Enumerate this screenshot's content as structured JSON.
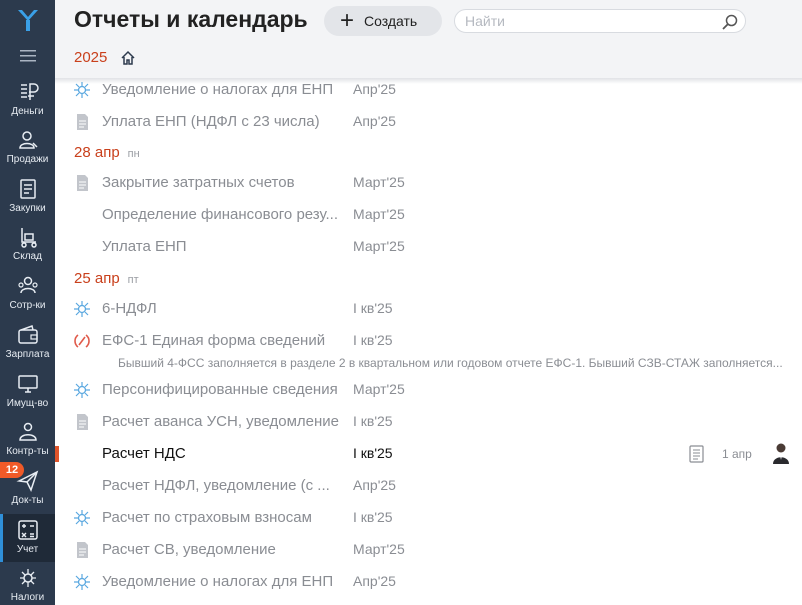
{
  "header": {
    "title": "Отчеты и календарь",
    "create_label": "Создать",
    "search_placeholder": "Найти",
    "year": "2025"
  },
  "sidebar": {
    "badge": "12",
    "items": [
      {
        "label": "Деньги",
        "icon": "money-icon"
      },
      {
        "label": "Продажи",
        "icon": "sales-icon"
      },
      {
        "label": "Закупки",
        "icon": "purchases-icon"
      },
      {
        "label": "Склад",
        "icon": "warehouse-icon"
      },
      {
        "label": "Сотр-ки",
        "icon": "employees-icon"
      },
      {
        "label": "Зарплата",
        "icon": "salary-icon"
      },
      {
        "label": "Имущ-во",
        "icon": "property-icon"
      },
      {
        "label": "Контр-ты",
        "icon": "contractors-icon"
      },
      {
        "label": "Док-ты",
        "icon": "documents-icon"
      },
      {
        "label": "Учет",
        "icon": "accounting-icon"
      },
      {
        "label": "Налоги",
        "icon": "taxes-icon"
      }
    ]
  },
  "list": {
    "rows": [
      {
        "name": "Уведомление о налогах для ЕНП",
        "period": "Апр'25",
        "icon": "fns-icon"
      },
      {
        "name": "Уплата ЕНП (НДФЛ с 23 числа)",
        "period": "Апр'25",
        "icon": "document-icon"
      },
      {
        "name": "Закрытие затратных счетов",
        "period": "Март'25",
        "icon": "document-icon"
      },
      {
        "name": "Определение финансового резу...",
        "period": "Март'25",
        "icon": ""
      },
      {
        "name": "Уплата ЕНП",
        "period": "Март'25",
        "icon": ""
      },
      {
        "name": "6-НДФЛ",
        "period": "I кв'25",
        "icon": "fns-icon"
      },
      {
        "name": "ЕФС-1 Единая форма сведений",
        "period": "I кв'25",
        "icon": "sfr-icon"
      },
      {
        "name": "Персонифицированные сведения",
        "period": "Март'25",
        "icon": "fns-icon"
      },
      {
        "name": "Расчет аванса УСН, уведомление",
        "period": "I кв'25",
        "icon": "document-icon"
      },
      {
        "name": "Расчет НДС",
        "period": "I кв'25",
        "icon": "",
        "due": "1 апр"
      },
      {
        "name": "Расчет НДФЛ, уведомление (с ...",
        "period": "Апр'25",
        "icon": ""
      },
      {
        "name": "Расчет по страховым взносам",
        "period": "I кв'25",
        "icon": "fns-icon"
      },
      {
        "name": "Расчет СВ, уведомление",
        "period": "Март'25",
        "icon": "document-icon"
      },
      {
        "name": "Уведомление о налогах для ЕНП",
        "period": "Апр'25",
        "icon": "fns-icon"
      }
    ],
    "dates": [
      {
        "day": "28 апр",
        "weekday": "пн"
      },
      {
        "day": "25 апр",
        "weekday": "пт"
      }
    ],
    "note": "Бывший 4-ФСС заполняется в разделе 2 в квартальном или годовом отчете ЕФС-1. Бывший СЗВ-СТАЖ заполняется..."
  }
}
